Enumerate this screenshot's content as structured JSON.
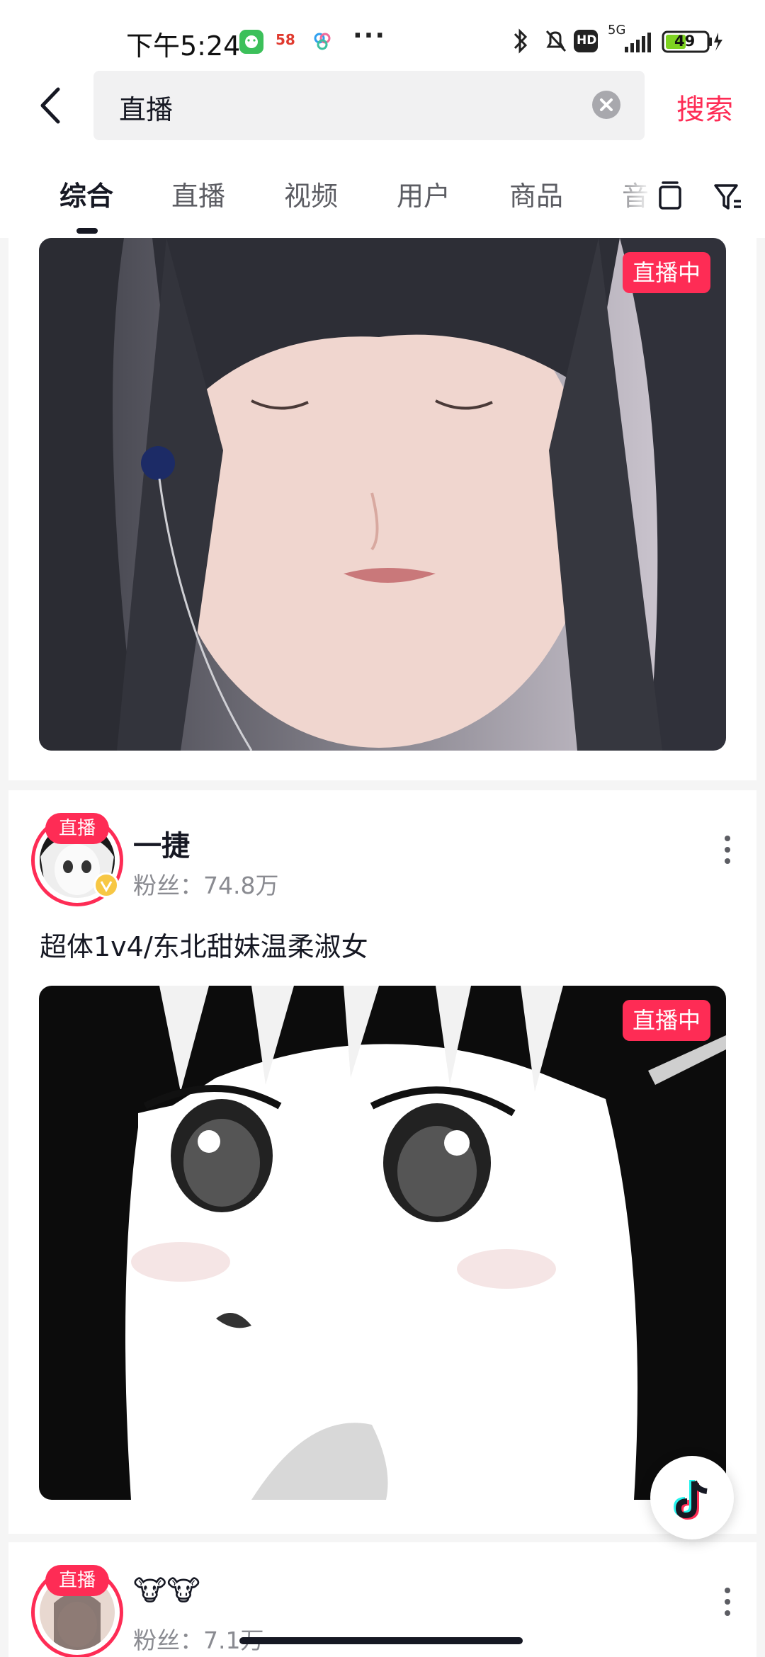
{
  "status_bar": {
    "time": "下午5:24",
    "app_badge_58": "58",
    "network": "5G",
    "hd_label": "HD",
    "battery": "49"
  },
  "header": {
    "query": "直播",
    "search_label": "搜索"
  },
  "tabs": [
    {
      "label": "综合",
      "active": true
    },
    {
      "label": "直播",
      "active": false
    },
    {
      "label": "视频",
      "active": false
    },
    {
      "label": "用户",
      "active": false
    },
    {
      "label": "商品",
      "active": false
    },
    {
      "label": "音",
      "active": false
    }
  ],
  "cards": [
    {
      "live_badge": "直播中",
      "cover": "girl-with-earphones"
    },
    {
      "avatar_tag": "直播",
      "name": "一捷",
      "fans": "粉丝：74.8万",
      "title": "超体1v4/东北甜妹温柔淑女",
      "live_badge": "直播中",
      "cover": "manga-girl"
    },
    {
      "avatar_tag": "直播",
      "name": "🐮🐮",
      "fans": "粉丝：7.1万"
    }
  ],
  "colors": {
    "accent": "#fe2c55",
    "text": "#161823",
    "secondary": "#8a8b91"
  }
}
